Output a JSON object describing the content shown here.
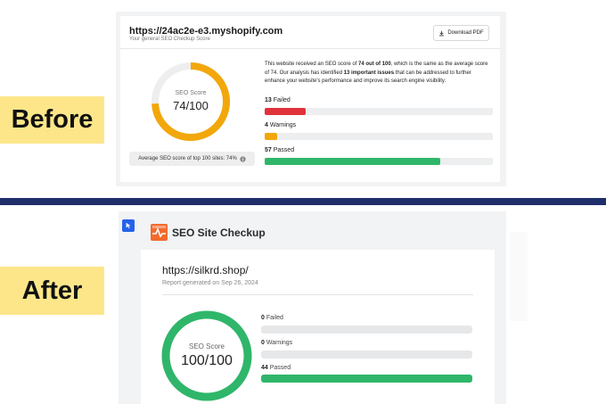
{
  "labels": {
    "before": "Before",
    "after": "After"
  },
  "before": {
    "url": "https://24ac2e-e3.myshopify.com",
    "subtitle": "Your general SEO Checkup Score",
    "download_label": "Download PDF",
    "score_label": "SEO Score",
    "score_text": "74/100",
    "score_value": 74,
    "average_text": "Average SEO score of top 100 sites: 74%",
    "description_parts": {
      "p1": "This website received an SEO score of ",
      "b1": "74 out of 100",
      "p2": ", which is the same as the average score of 74. Our analysis has identified ",
      "b2": "13 important issues",
      "p3": " that can be addressed to further enhance your website's performance and improve its search engine visibility."
    },
    "rows": [
      {
        "count": "13",
        "label": "Failed",
        "fraction": 0.18,
        "color": "#e0323b"
      },
      {
        "count": "4",
        "label": "Warnings",
        "fraction": 0.055,
        "color": "#f2a70a"
      },
      {
        "count": "57",
        "label": "Passed",
        "fraction": 0.77,
        "color": "#2fb66a"
      }
    ],
    "ring_color": "#f2a70a",
    "ring_track": "#eeeeee"
  },
  "after": {
    "brand": "SEO Site Checkup",
    "url": "https://silkrd.shop/",
    "subtitle": "Report generated on Sep 26, 2024",
    "score_label": "SEO Score",
    "score_text": "100/100",
    "score_value": 100,
    "rows": [
      {
        "count": "0",
        "label": "Failed",
        "fraction": 0,
        "color": "#e0323b"
      },
      {
        "count": "0",
        "label": "Warnings",
        "fraction": 0,
        "color": "#f2a70a"
      },
      {
        "count": "44",
        "label": "Passed",
        "fraction": 1,
        "color": "#2fb66a"
      }
    ],
    "ring_color": "#2fb66a"
  },
  "colors": {
    "divider": "#1f2f6b",
    "tag_bg": "#fde68a",
    "cursor": "#2563eb",
    "logo": "#f26a2e"
  },
  "icons": {
    "download": "download-icon",
    "info": "info-icon",
    "cursor": "cursor-arrow-icon",
    "logo": "pulse-logo-icon"
  }
}
